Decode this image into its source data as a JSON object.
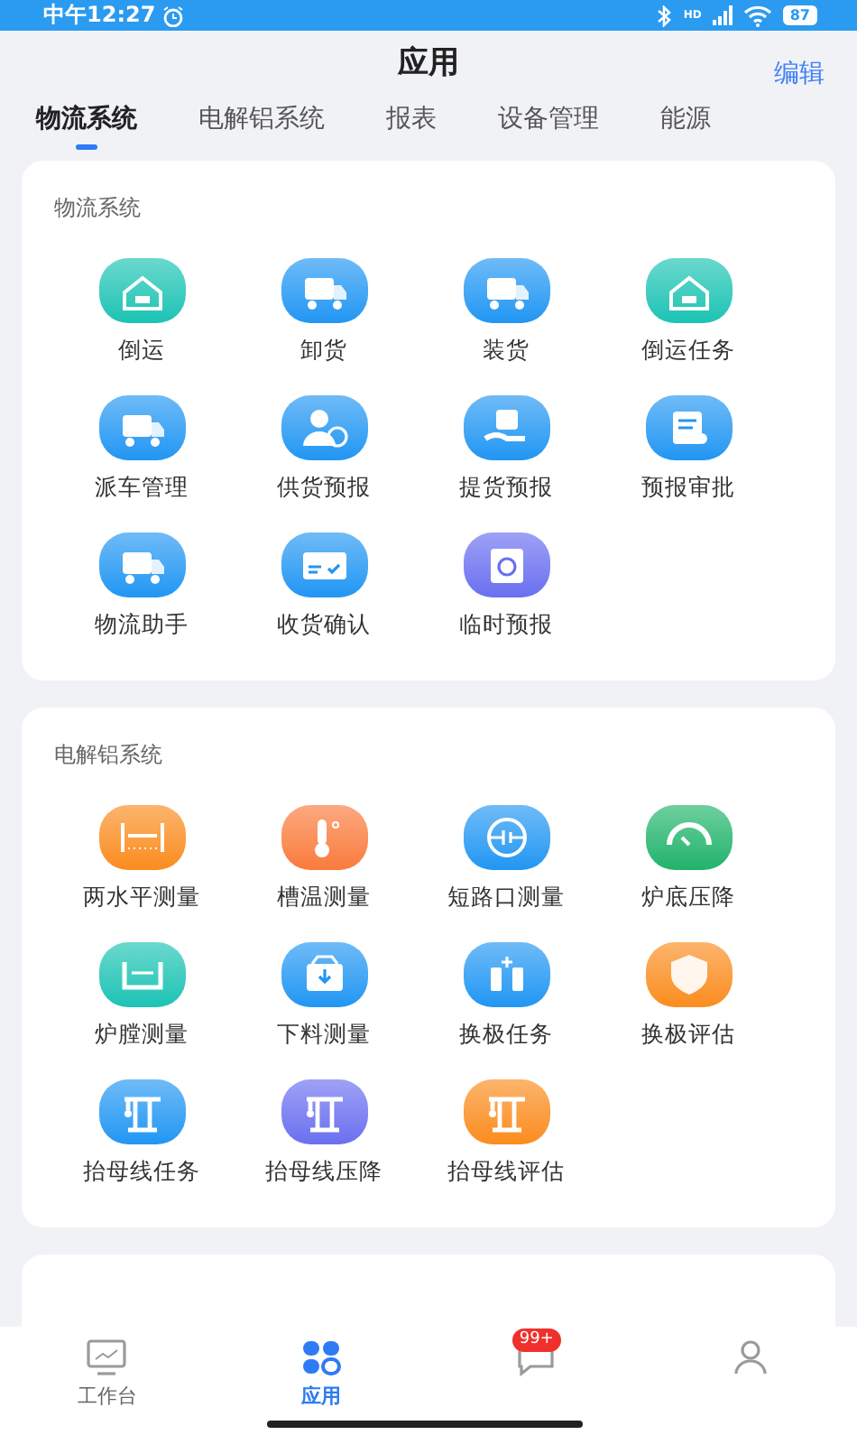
{
  "status_bar": {
    "time": "中午12:27",
    "network": "HD",
    "battery": "87"
  },
  "header": {
    "title": "应用",
    "action": "编辑"
  },
  "tabs": [
    {
      "label": "物流系统",
      "selected": true
    },
    {
      "label": "电解铝系统",
      "selected": false
    },
    {
      "label": "报表",
      "selected": false
    },
    {
      "label": "设备管理",
      "selected": false
    },
    {
      "label": "能源",
      "selected": false
    }
  ],
  "sections": [
    {
      "title": "物流系统",
      "items": [
        {
          "label": "倒运",
          "color": "#1cc3b4"
        },
        {
          "label": "卸货",
          "color": "#2196f3"
        },
        {
          "label": "装货",
          "color": "#2196f3"
        },
        {
          "label": "倒运任务",
          "color": "#1cc3b4"
        },
        {
          "label": "派车管理",
          "color": "#2196f3"
        },
        {
          "label": "供货预报",
          "color": "#2196f3"
        },
        {
          "label": "提货预报",
          "color": "#2196f3"
        },
        {
          "label": "预报审批",
          "color": "#2196f3"
        },
        {
          "label": "物流助手",
          "color": "#2196f3"
        },
        {
          "label": "收货确认",
          "color": "#2196f3"
        },
        {
          "label": "临时预报",
          "color": "#6a6ff0"
        }
      ]
    },
    {
      "title": "电解铝系统",
      "items": [
        {
          "label": "两水平测量",
          "color": "#fb8c1e"
        },
        {
          "label": "槽温测量",
          "color": "#fa7a3c"
        },
        {
          "label": "短路口测量",
          "color": "#2196f3"
        },
        {
          "label": "炉底压降",
          "color": "#21b36b"
        },
        {
          "label": "炉膛测量",
          "color": "#1cc3b4"
        },
        {
          "label": "下料测量",
          "color": "#2196f3"
        },
        {
          "label": "换极任务",
          "color": "#2196f3"
        },
        {
          "label": "换极评估",
          "color": "#fb8c1e"
        },
        {
          "label": "抬母线任务",
          "color": "#2196f3"
        },
        {
          "label": "抬母线压降",
          "color": "#6a6ff0"
        },
        {
          "label": "抬母线评估",
          "color": "#fb8c1e"
        }
      ]
    }
  ],
  "bottom_nav": [
    {
      "label": "工作台",
      "selected": false
    },
    {
      "label": "应用",
      "selected": true
    },
    {
      "badge": "99+",
      "selected": false
    },
    {
      "selected": false
    }
  ]
}
